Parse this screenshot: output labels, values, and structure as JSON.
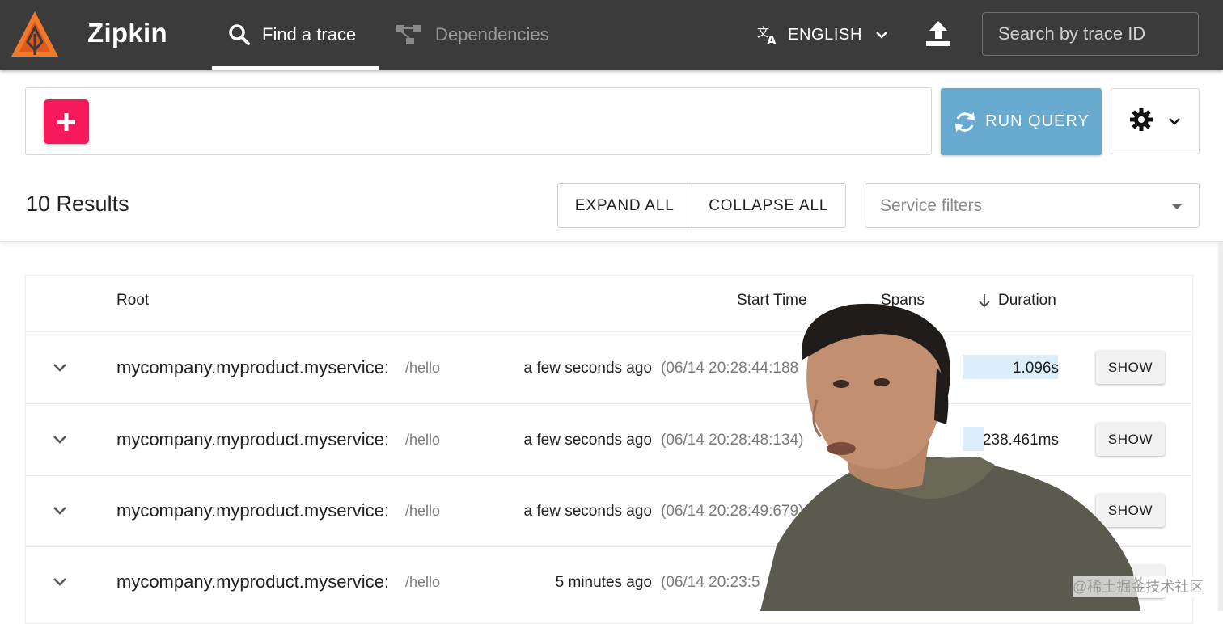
{
  "app": {
    "brand": "Zipkin",
    "nav": [
      {
        "label": "Find a trace",
        "icon": "search-icon",
        "active": true
      },
      {
        "label": "Dependencies",
        "icon": "dependencies-icon",
        "active": false
      }
    ],
    "language": "ENGLISH",
    "trace_search_placeholder": "Search by trace ID",
    "accent_color": "#68a9cf",
    "add_button_color": "#f5195c"
  },
  "query": {
    "run_label": "RUN QUERY"
  },
  "results": {
    "count_label": "10 Results",
    "expand_all": "EXPAND ALL",
    "collapse_all": "COLLAPSE ALL",
    "service_filter_placeholder": "Service filters"
  },
  "table": {
    "columns": {
      "root": "Root",
      "start_time": "Start Time",
      "spans": "Spans",
      "duration": "Duration"
    },
    "rows": [
      {
        "service": "mycompany.myproduct.myservice:",
        "path": "/hello",
        "relative": "a few seconds ago",
        "absolute": "(06/14 20:28:44:188",
        "duration": "1.096s",
        "duration_fraction": 1.0,
        "action": "SHOW"
      },
      {
        "service": "mycompany.myproduct.myservice:",
        "path": "/hello",
        "relative": "a few seconds ago",
        "absolute": "(06/14 20:28:48:134)",
        "duration": "238.461ms",
        "duration_fraction": 0.22,
        "action": "SHOW"
      },
      {
        "service": "mycompany.myproduct.myservice:",
        "path": "/hello",
        "relative": "a few seconds ago",
        "absolute": "(06/14 20:28:49:679)",
        "duration": "",
        "duration_fraction": 0,
        "action": "SHOW"
      },
      {
        "service": "mycompany.myproduct.myservice:",
        "path": "/hello",
        "relative": "5 minutes ago",
        "absolute": "(06/14 20:23:5",
        "duration": "",
        "duration_fraction": 0,
        "action": "OW"
      }
    ]
  },
  "watermark": "@稀土掘金技术社区"
}
